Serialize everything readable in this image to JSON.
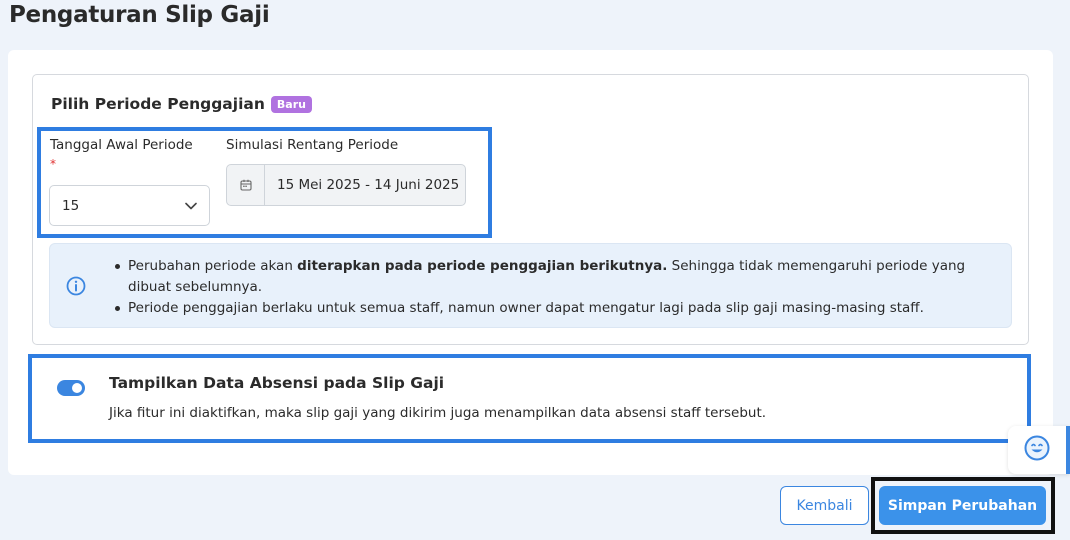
{
  "page": {
    "title": "Pengaturan Slip Gaji"
  },
  "period_section": {
    "title": "Pilih Periode Penggajian",
    "badge": "Baru",
    "start_date_label": "Tanggal Awal Periode",
    "required_mark": "*",
    "start_date_value": "15",
    "simulation_label": "Simulasi Rentang Periode",
    "simulation_value": "15 Mei 2025 - 14 Juni 2025",
    "info_bullet_1_pre": "Perubahan periode akan ",
    "info_bullet_1_bold": "diterapkan pada periode penggajian berikutnya.",
    "info_bullet_1_post": " Sehingga tidak memengaruhi periode yang dibuat sebelumnya.",
    "info_bullet_2": "Periode penggajian berlaku untuk semua staff, namun owner dapat mengatur lagi pada slip gaji masing-masing staff."
  },
  "attendance_section": {
    "toggle_on": true,
    "title": "Tampilkan Data Absensi pada Slip Gaji",
    "description": "Jika fitur ini diaktifkan, maka slip gaji yang dikirim juga menampilkan data absensi staff tersebut."
  },
  "actions": {
    "back_label": "Kembali",
    "save_label": "Simpan Perubahan"
  },
  "colors": {
    "accent": "#3b86e0",
    "badge": "#b072e0",
    "info_bg": "#e8f1fb",
    "highlight_blue": "#2f7de1",
    "highlight_black": "#111111"
  },
  "icons": {
    "select_chevron": "chevron-down-icon",
    "date": "calendar-icon",
    "info": "info-icon",
    "feedback": "smiley-icon"
  }
}
